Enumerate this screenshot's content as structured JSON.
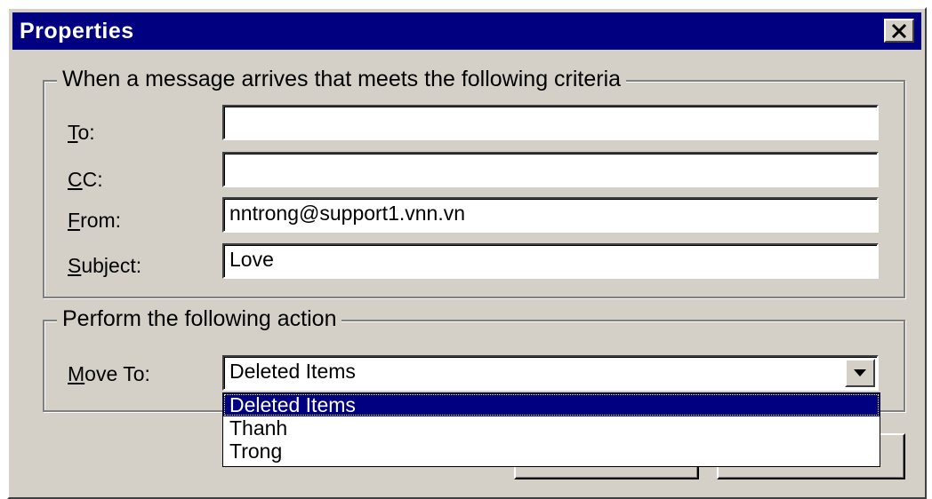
{
  "window": {
    "title": "Properties",
    "close_icon": "close-icon"
  },
  "criteria_group": {
    "legend": "When a message arrives that meets the following criteria",
    "to": {
      "label_accel": "T",
      "label_rest": "o:",
      "value": ""
    },
    "cc": {
      "label_accel": "C",
      "label_rest": "C:",
      "value": ""
    },
    "from": {
      "label_accel": "F",
      "label_rest": "rom:",
      "value": "nntrong@support1.vnn.vn"
    },
    "subject": {
      "label_accel": "S",
      "label_rest": "ubject:",
      "value": "Love"
    }
  },
  "action_group": {
    "legend": "Perform the following action",
    "move_to": {
      "label_accel": "M",
      "label_rest": "ove To:",
      "selected": "Deleted Items",
      "arrow_icon": "chevron-down-icon",
      "options": [
        "Deleted Items",
        "Thanh",
        "Trong"
      ]
    }
  },
  "colors": {
    "titlebar": "#000080",
    "dialog_face": "#d4d0c8",
    "selection": "#000080"
  }
}
